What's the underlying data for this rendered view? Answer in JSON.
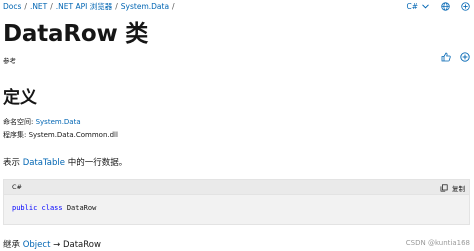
{
  "breadcrumb": [
    {
      "label": "Docs"
    },
    {
      "label": ".NET"
    },
    {
      "label": ".NET API 浏览器"
    },
    {
      "label": "System.Data"
    }
  ],
  "breadcrumb_separator": "/",
  "toolbar": {
    "language": "C#",
    "icons": [
      "chevron-down-icon",
      "globe-icon",
      "plus-circle-icon"
    ]
  },
  "page": {
    "title": "DataRow 类",
    "reference_label": "参考"
  },
  "definition": {
    "heading": "定义",
    "namespace_label": "命名空间:",
    "namespace_value": "System.Data",
    "assembly_label": "程序集:",
    "assembly_value": "System.Data.Common.dll",
    "desc_prefix": "表示",
    "desc_link": "DataTable",
    "desc_suffix": "中的一行数据。"
  },
  "code": {
    "language": "C#",
    "copy_label": "复制",
    "kw_public": "public",
    "kw_class": "class",
    "type_name": "DataRow"
  },
  "inheritance": {
    "label": "继承",
    "base": "Object",
    "arrow": "→",
    "derived": "DataRow"
  },
  "watermark": "CSDN @kuntia168",
  "colors": {
    "link": "#0065b3",
    "keyword": "#0000ff",
    "code_background": "#f2f2f2"
  }
}
